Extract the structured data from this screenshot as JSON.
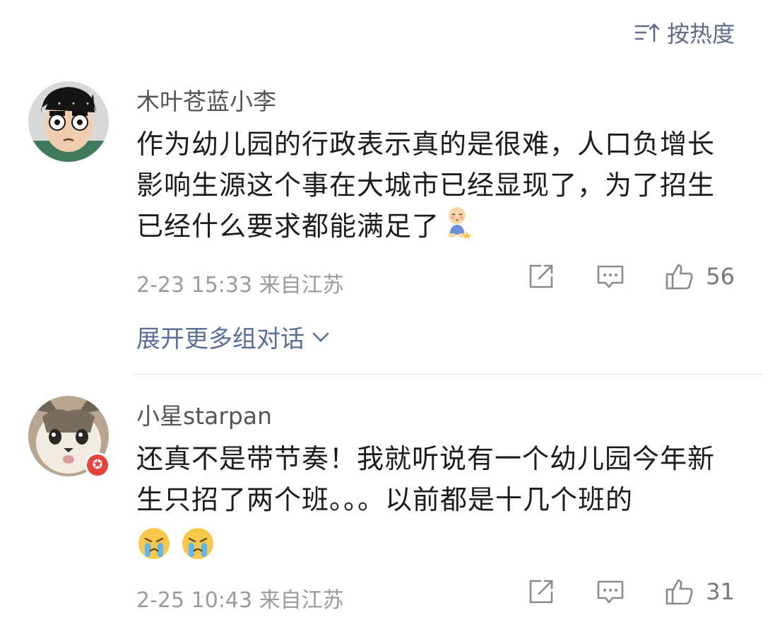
{
  "sort": {
    "label": "按热度",
    "icon": "sort-icon"
  },
  "comments": [
    {
      "username": "木叶苍蓝小李",
      "text": "作为幼儿园的行政表示真的是很难，人口负增长影响生源这个事在大城市已经显现了，为了招生已经什么要求都能满足了",
      "emoji": "shy-sitting-emoji",
      "time": "2-23 15:33 来自江苏",
      "likes": "56",
      "expand": "展开更多组对话"
    },
    {
      "username": "小星starpan",
      "text": "还真不是带节奏！我就听说有一个幼儿园今年新生只招了两个班。。。以前都是十几个班的",
      "emoji": "crying-emoji",
      "time": "2-25 10:43 来自江苏",
      "likes": "31"
    }
  ],
  "colors": {
    "link": "#5a6f98",
    "meta": "#9a9a9a",
    "badge": "#e5423b"
  }
}
